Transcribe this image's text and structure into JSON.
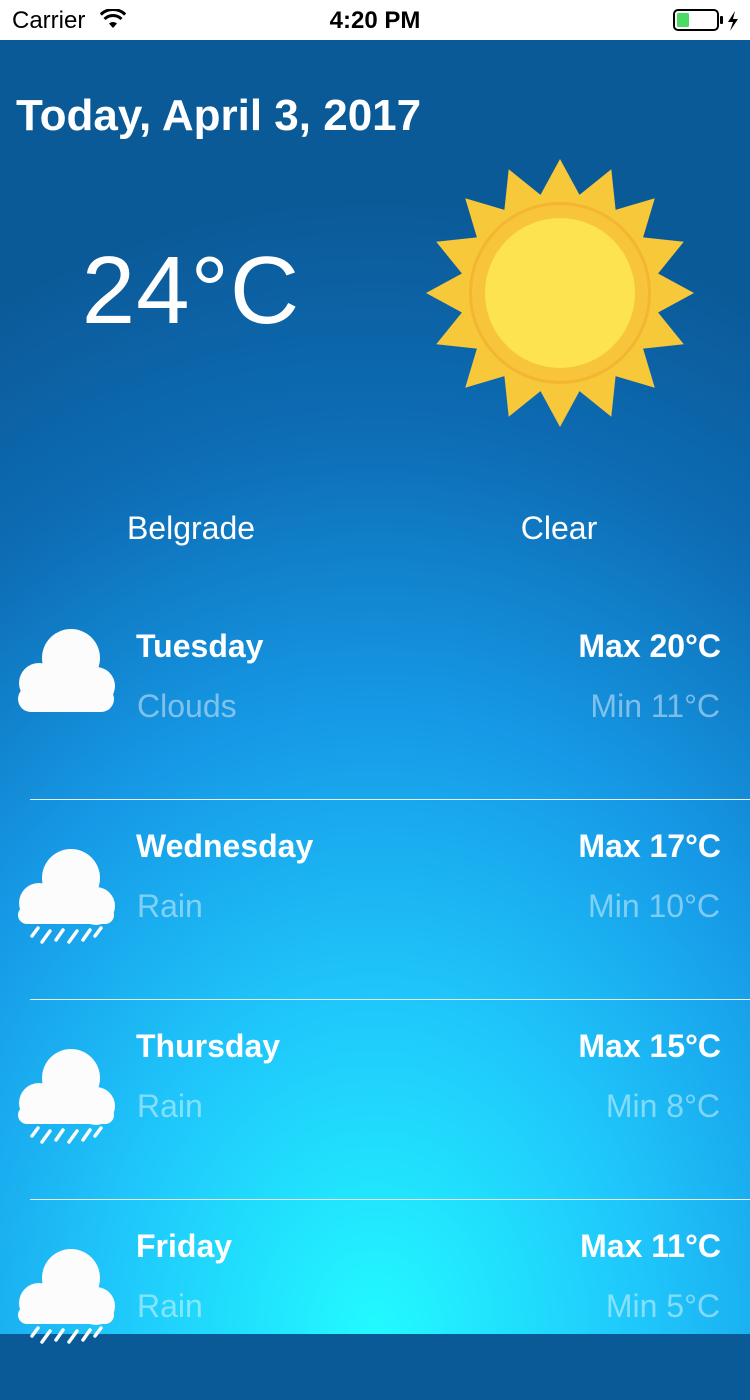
{
  "status_bar": {
    "carrier": "Carrier",
    "time": "4:20 PM",
    "icons": [
      "wifi-icon",
      "battery-icon"
    ]
  },
  "today": {
    "date": "Today, April 3, 2017",
    "temperature": "24°C",
    "city": "Belgrade",
    "condition": "Clear",
    "icon": "sun-icon"
  },
  "forecast": [
    {
      "day": "Tuesday",
      "summary": "Clouds",
      "max": "Max 20°C",
      "min": "Min 11°C",
      "icon": "cloud-icon"
    },
    {
      "day": "Wednesday",
      "summary": "Rain",
      "max": "Max 17°C",
      "min": "Min 10°C",
      "icon": "rain-cloud-icon"
    },
    {
      "day": "Thursday",
      "summary": "Rain",
      "max": "Max 15°C",
      "min": "Min 8°C",
      "icon": "rain-cloud-icon"
    },
    {
      "day": "Friday",
      "summary": "Rain",
      "max": "Max 11°C",
      "min": "Min 5°C",
      "icon": "rain-cloud-icon"
    }
  ],
  "colors": {
    "background_top": "#0b5a98",
    "background_bottom": "#22faff",
    "sun_core": "#fce34f",
    "sun_rays": "#f6c83a",
    "battery": "#4cd964"
  }
}
